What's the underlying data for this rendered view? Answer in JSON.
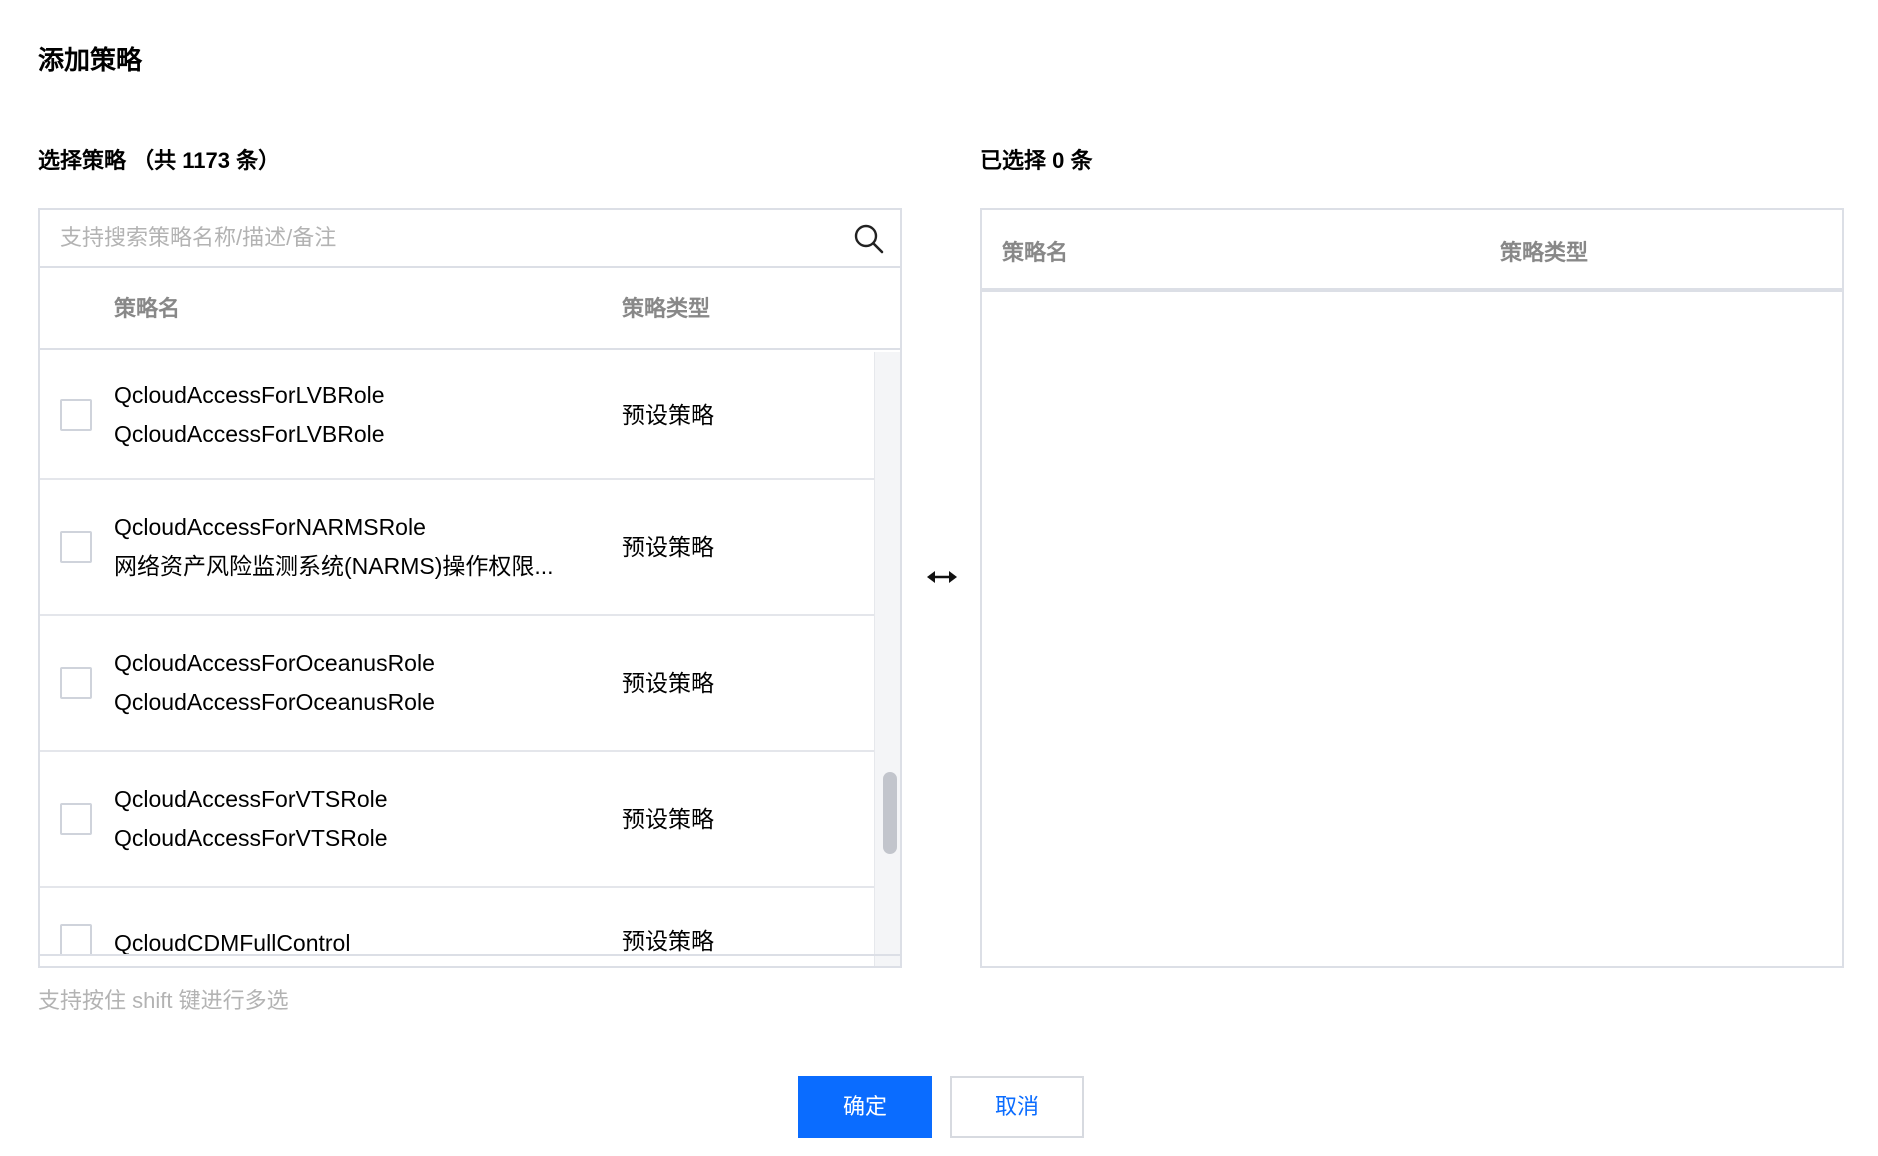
{
  "dialog": {
    "title": "添加策略"
  },
  "left": {
    "section_title": "选择策略 （共 1173 条）",
    "search_placeholder": "支持搜索策略名称/描述/备注",
    "col_name": "策略名",
    "col_type": "策略类型",
    "rows": [
      {
        "name": "QcloudAccessForLVBRole",
        "desc": "QcloudAccessForLVBRole",
        "type": "预设策略",
        "checked": false
      },
      {
        "name": "QcloudAccessForNARMSRole",
        "desc": "网络资产风险监测系统(NARMS)操作权限...",
        "type": "预设策略",
        "checked": false
      },
      {
        "name": "QcloudAccessForOceanusRole",
        "desc": "QcloudAccessForOceanusRole",
        "type": "预设策略",
        "checked": false
      },
      {
        "name": "QcloudAccessForVTSRole",
        "desc": "QcloudAccessForVTSRole",
        "type": "预设策略",
        "checked": false
      },
      {
        "name": "QcloudCDMFullControl",
        "type": "预设策略",
        "checked": false
      }
    ],
    "hint": "支持按住 shift 键进行多选"
  },
  "right": {
    "section_title": "已选择 0 条",
    "col_name": "策略名",
    "col_type": "策略类型"
  },
  "buttons": {
    "confirm": "确定",
    "cancel": "取消"
  },
  "colors": {
    "primary": "#0a6cff",
    "border": "#dcdfe6",
    "muted_text": "#888888",
    "placeholder": "#b3b3b3"
  },
  "icons": {
    "search": "search-icon",
    "swap": "swap-icon"
  }
}
